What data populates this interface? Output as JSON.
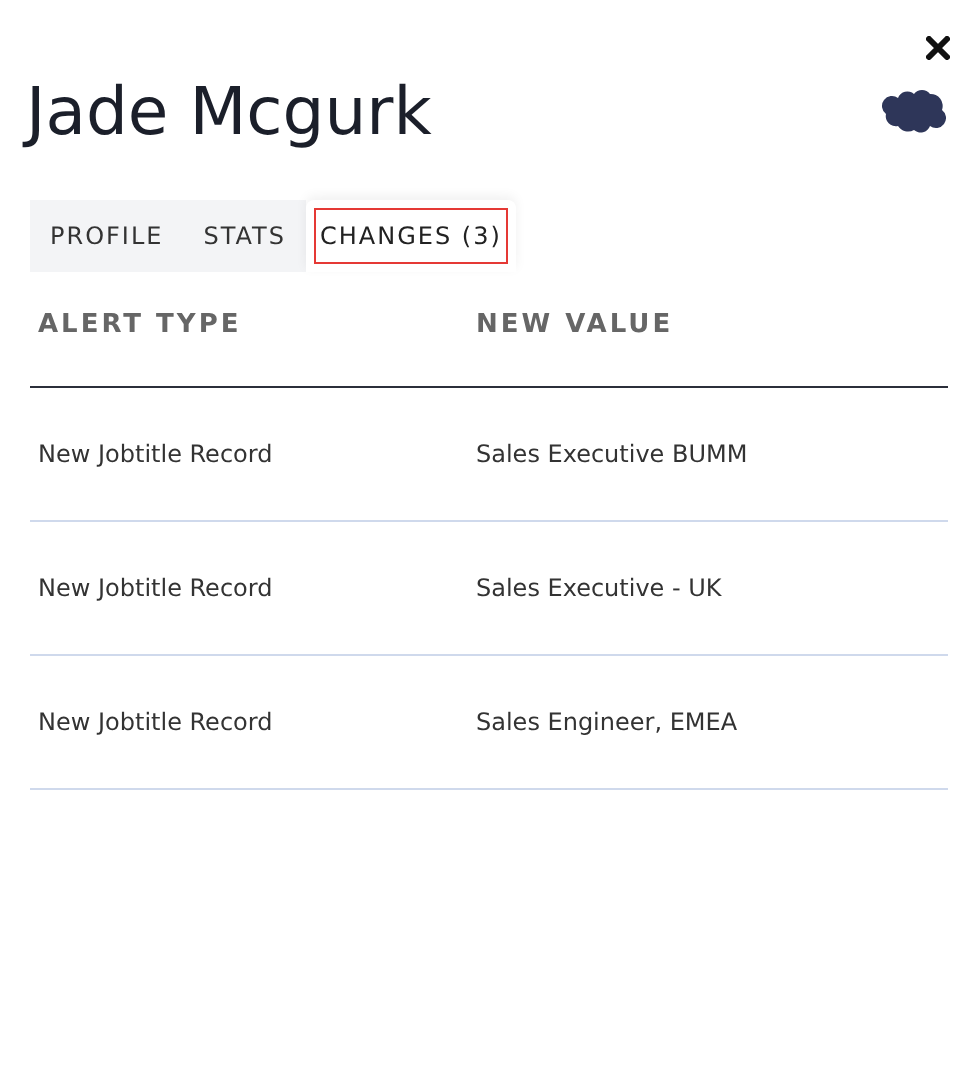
{
  "title": "Jade Mcgurk",
  "tabs": [
    {
      "label": "PROFILE",
      "selected": false
    },
    {
      "label": "STATS",
      "selected": false
    },
    {
      "label": "CHANGES (3)",
      "selected": true
    }
  ],
  "table": {
    "columns": [
      "ALERT TYPE",
      "NEW VALUE"
    ],
    "rows": [
      [
        "New Jobtitle Record",
        "Sales Executive BUMM"
      ],
      [
        "New Jobtitle Record",
        "Sales Executive - UK"
      ],
      [
        "New Jobtitle Record",
        "Sales Engineer, EMEA"
      ]
    ]
  }
}
